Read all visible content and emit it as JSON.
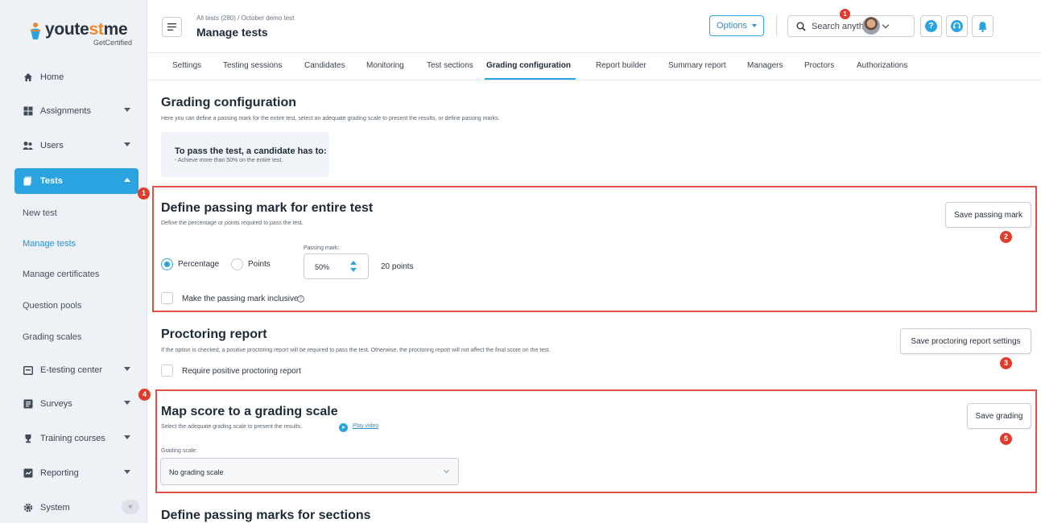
{
  "brand": {
    "name_part1": "youte",
    "name_part2": "st",
    "name_part3": "me",
    "tagline": "GetCertified"
  },
  "sidebar": {
    "items": [
      {
        "label": "Home",
        "icon": "home-icon"
      },
      {
        "label": "Assignments",
        "icon": "assignments-icon"
      },
      {
        "label": "Users",
        "icon": "users-icon"
      },
      {
        "label": "Tests",
        "icon": "tests-icon"
      },
      {
        "label": "E-testing center",
        "icon": "calendar-icon"
      },
      {
        "label": "Surveys",
        "icon": "surveys-icon"
      },
      {
        "label": "Training courses",
        "icon": "trophy-icon"
      },
      {
        "label": "Reporting",
        "icon": "reporting-icon"
      },
      {
        "label": "System",
        "icon": "gear-icon"
      }
    ],
    "subitems": [
      "New test",
      "Manage tests",
      "Manage certificates",
      "Question pools",
      "Grading scales"
    ],
    "collapse_label": "«"
  },
  "header": {
    "breadcrumb": "All tests (280)  /  October demo test",
    "title": "Manage tests",
    "options_label": "Options",
    "search_placeholder": "Search anything",
    "notification_count": "1"
  },
  "tabs": [
    "Settings",
    "Testing sessions",
    "Candidates",
    "Monitoring",
    "Test sections",
    "Grading configuration",
    "Report builder",
    "Summary report",
    "Managers",
    "Proctors",
    "Authorizations"
  ],
  "grading": {
    "title": "Grading configuration",
    "description": "Here you can define a passing mark for the entire test, select an adequate grading scale to present the results, or define passing marks.",
    "card_title": "To pass the test, a candidate has to:",
    "card_text": "- Achieve more than 50% on the entire test."
  },
  "passing_mark": {
    "title": "Define passing mark for entire test",
    "description": "Define the percentage or points required to pass the test.",
    "save_label": "Save passing mark",
    "option_percentage": "Percentage",
    "option_points": "Points",
    "field_label": "Passing mark:",
    "value": "50%",
    "points_text": "20 points",
    "inclusive_label": "Make the passing mark inclusive"
  },
  "proctoring": {
    "title": "Proctoring report",
    "description": "If the option is checked, a positive proctoring report will be required to pass the test. Otherwise, the proctoring report will not affect the final score on the test.",
    "save_label": "Save proctoring report settings",
    "checkbox_label": "Require positive proctoring report"
  },
  "grading_scale": {
    "title": "Map score to a grading scale",
    "description": "Select the adequate grading scale to present the results.",
    "video_link": "Play video",
    "save_label": "Save grading",
    "field_label": "Grading scale:",
    "selected": "No grading scale"
  },
  "sections": {
    "title": "Define passing marks for sections"
  },
  "markers": [
    "1",
    "2",
    "3",
    "4",
    "5"
  ],
  "colors": {
    "accent": "#2aa4e0",
    "marker": "#e03b2c",
    "brand_orange": "#f0882c"
  }
}
